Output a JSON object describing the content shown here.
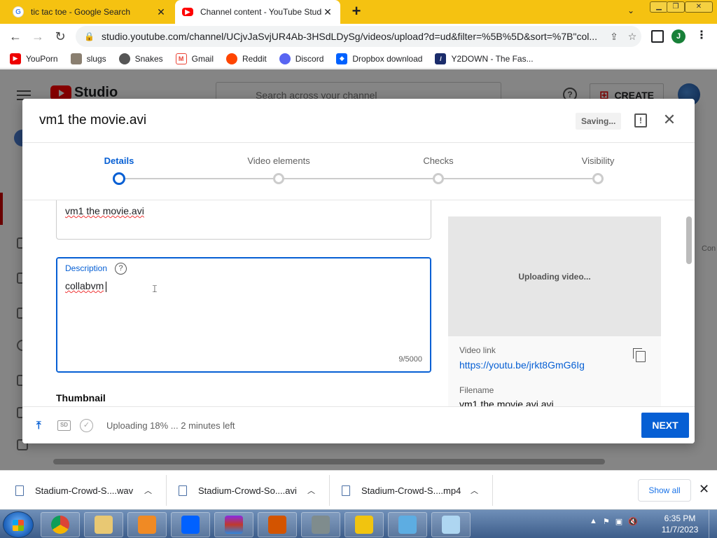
{
  "browser": {
    "tabs": [
      {
        "title": "tic tac toe - Google Search",
        "favicon": "G",
        "active": false
      },
      {
        "title": "Channel content - YouTube Studio",
        "active": true
      }
    ],
    "url": "studio.youtube.com/channel/UCjvJaSvjUR4Ab-3HSdLDySg/videos/upload?d=ud&filter=%5B%5D&sort=%7B\"col...",
    "profile_initial": "J",
    "bookmarks": [
      "YouPorn",
      "slugs",
      "Snakes",
      "Gmail",
      "Reddit",
      "Discord",
      "Dropbox download",
      "Y2DOWN - The Fas..."
    ]
  },
  "studio": {
    "logo_text": "Studio",
    "search_placeholder": "Search across your channel",
    "create_label": "CREATE",
    "right_edge_text": "Con"
  },
  "dialog": {
    "title": "vm1 the movie.avi",
    "saving": "Saving...",
    "steps": [
      {
        "label": "Details",
        "active": true
      },
      {
        "label": "Video elements",
        "active": false
      },
      {
        "label": "Checks",
        "active": false
      },
      {
        "label": "Visibility",
        "active": false
      }
    ],
    "title_field_value": "vm1 the movie.avi",
    "description": {
      "label": "Description",
      "value": "collabvm",
      "count": "9/5000"
    },
    "thumbnail_heading": "Thumbnail",
    "preview_text": "Uploading video...",
    "video_link_label": "Video link",
    "video_link": "https://youtu.be/jrkt8GmG6Ig",
    "filename_label": "Filename",
    "filename": "vm1 the movie.avi.avi",
    "upload_status": "Uploading 18% ... 2 minutes left",
    "next_label": "NEXT"
  },
  "downloads": {
    "items": [
      "Stadium-Crowd-S....wav",
      "Stadium-Crowd-So....avi",
      "Stadium-Crowd-S....mp4"
    ],
    "show_all": "Show all"
  },
  "taskbar": {
    "time": "6:35 PM",
    "date": "11/7/2023"
  },
  "colors": {
    "accent": "#065fd4",
    "chrome_frame": "#f5c211",
    "youtube_red": "#ff0000"
  }
}
